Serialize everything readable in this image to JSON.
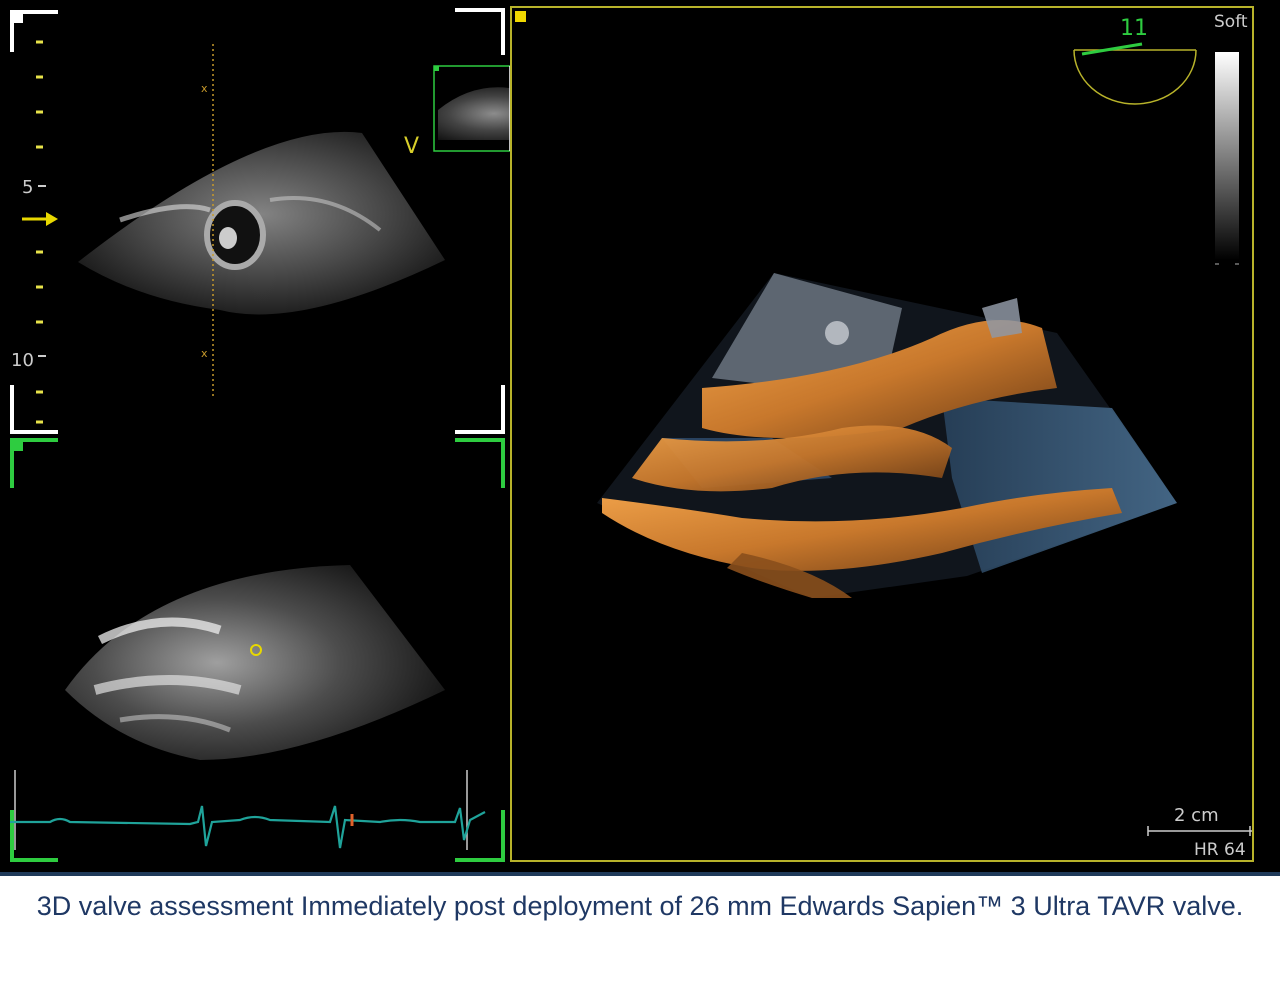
{
  "left_panel": {
    "depth_marks": [
      "5",
      "10"
    ],
    "view_marker": "V"
  },
  "right_panel": {
    "angle_value": "11",
    "map_label": "Soft",
    "scale_label": "2 cm",
    "heart_rate": "HR 64"
  },
  "caption": "3D valve assessment Immediately post deployment of 26 mm Edwards Sapien™ 3 Ultra TAVR valve.",
  "colors": {
    "frame_white": "#ffffff",
    "frame_green": "#2ecc40",
    "frame_yellow": "#b8b32a",
    "ecg": "#1fa39a",
    "caption": "#1f3864",
    "tissue_orange": "#c8782c",
    "blood_blue": "#3d5f80"
  }
}
